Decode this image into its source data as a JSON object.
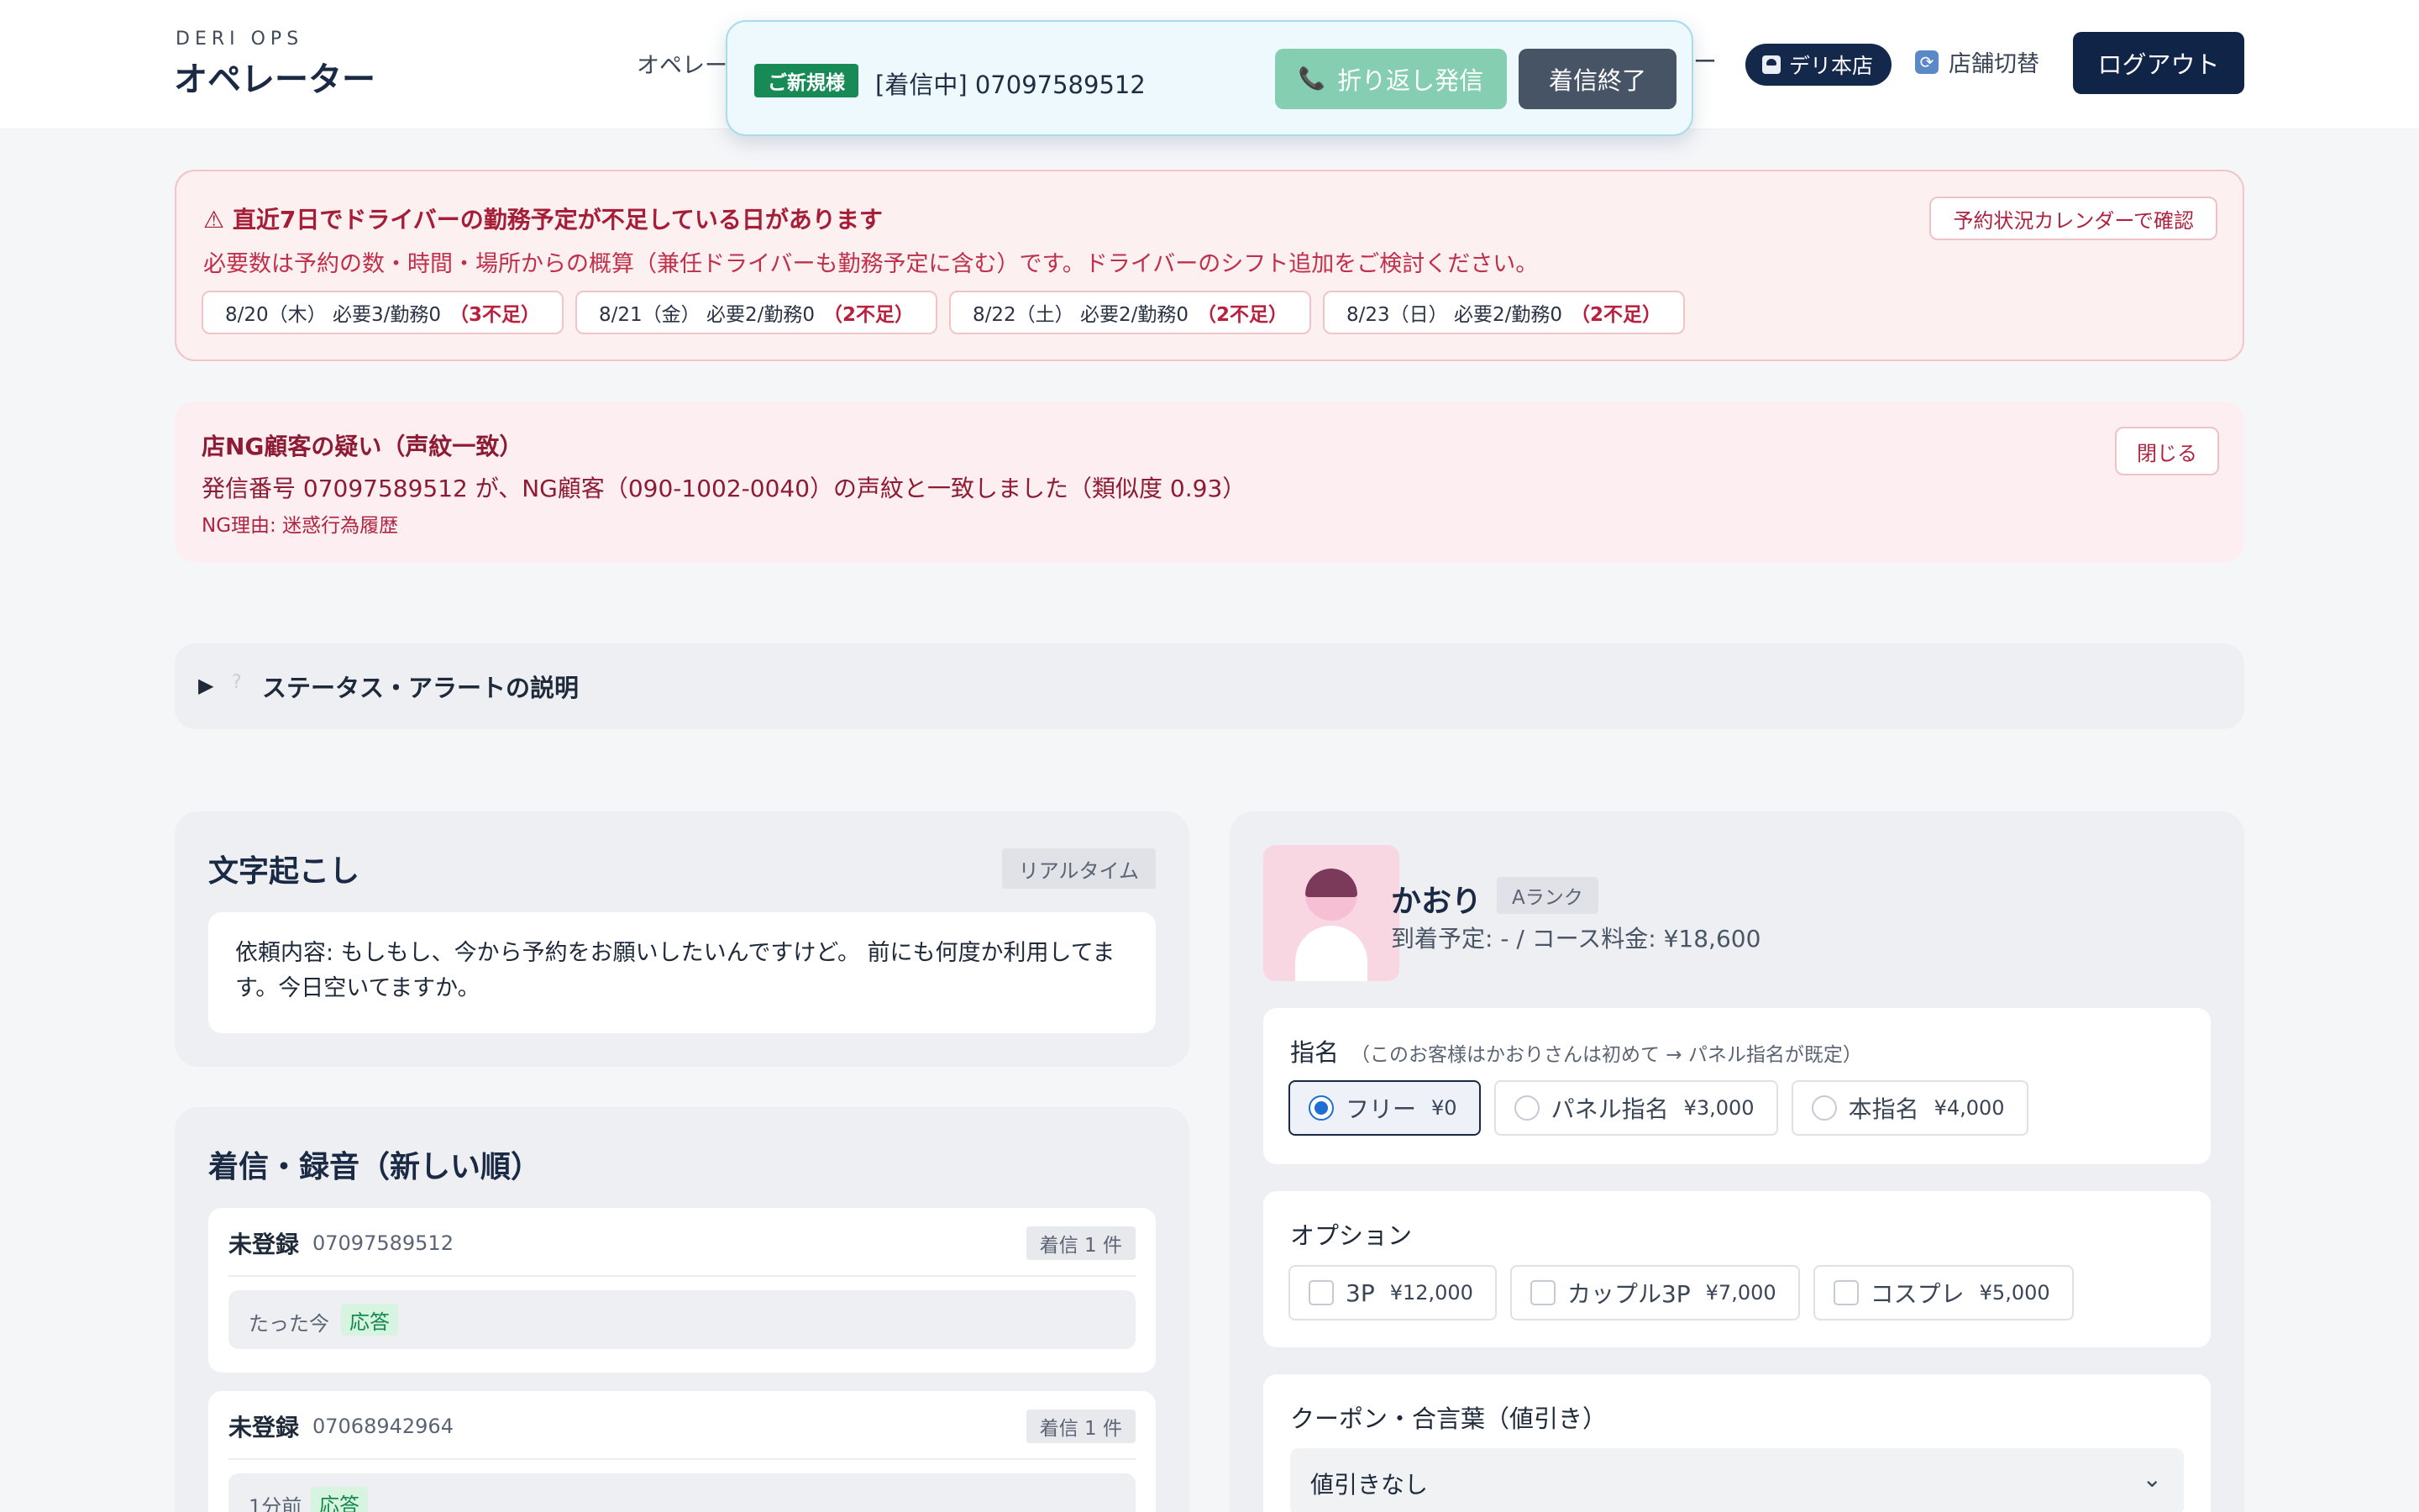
{
  "header": {
    "brand_small": "DERI OPS",
    "brand_title": "オペレーター",
    "nav_item": "オペレー",
    "nav_dash": "ー",
    "store_name": "デリ本店",
    "store_switch": "店舗切替",
    "logout": "ログアウト"
  },
  "call_popup": {
    "badge": "ご新規様",
    "text": "[着信中] 07097589512",
    "callback_label": "折り返し発信",
    "callback_icon": "📞",
    "end_label": "着信終了"
  },
  "shortage_alert": {
    "title": "⚠ 直近7日でドライバーの勤務予定が不足している日があります",
    "description": "必要数は予約の数・時間・場所からの概算（兼任ドライバーも勤務予定に含む）です。ドライバーのシフト追加をご検討ください。",
    "calendar_button": "予約状況カレンダーで確認",
    "days": [
      {
        "text": "8/20（木） 必要3/勤務0",
        "short": "（3不足）"
      },
      {
        "text": "8/21（金） 必要2/勤務0",
        "short": "（2不足）"
      },
      {
        "text": "8/22（土） 必要2/勤務0",
        "short": "（2不足）"
      },
      {
        "text": "8/23（日） 必要2/勤務0",
        "short": "（2不足）"
      }
    ]
  },
  "ng_alert": {
    "title": "店NG顧客の疑い（声紋一致）",
    "description": "発信番号 07097589512 が、NG顧客（090-1002-0040）の声紋と一致しました（類似度 0.93）",
    "reason": "NG理由: 迷惑行為履歴",
    "close_button": "閉じる"
  },
  "legend": {
    "arrow": "▶",
    "help": "?",
    "label": "ステータス・アラートの説明"
  },
  "transcript": {
    "title": "文字起こし",
    "tag": "リアルタイム",
    "text": "依頼内容: もしもし、今から予約をお願いしたいんですけど。 前にも何度か利用してます。今日空いてますか。"
  },
  "calls": {
    "title": "着信・録音（新しい順）",
    "items": [
      {
        "name": "未登録",
        "number": "07097589512",
        "count": "着信 1 件",
        "time": "たった今",
        "status": "応答"
      },
      {
        "name": "未登録",
        "number": "07068942964",
        "count": "着信 1 件",
        "time": "1分前",
        "status": "応答"
      }
    ]
  },
  "cast": {
    "name": "かおり",
    "rank": "Aランク",
    "subtitle": "到着予定: - / コース料金: ¥18,600"
  },
  "nomination": {
    "label": "指名",
    "note": "（このお客様はかおりさんは初めて → パネル指名が既定）",
    "options": [
      {
        "label": "フリー",
        "price": "¥0",
        "selected": true
      },
      {
        "label": "パネル指名",
        "price": "¥3,000",
        "selected": false
      },
      {
        "label": "本指名",
        "price": "¥4,000",
        "selected": false
      }
    ]
  },
  "options_section": {
    "label": "オプション",
    "options": [
      {
        "label": "3P",
        "price": "¥12,000"
      },
      {
        "label": "カップル3P",
        "price": "¥7,000"
      },
      {
        "label": "コスプレ",
        "price": "¥5,000"
      }
    ]
  },
  "coupon": {
    "label": "クーポン・合言葉（値引き）",
    "value": "値引きなし",
    "chevron": "⌄"
  }
}
